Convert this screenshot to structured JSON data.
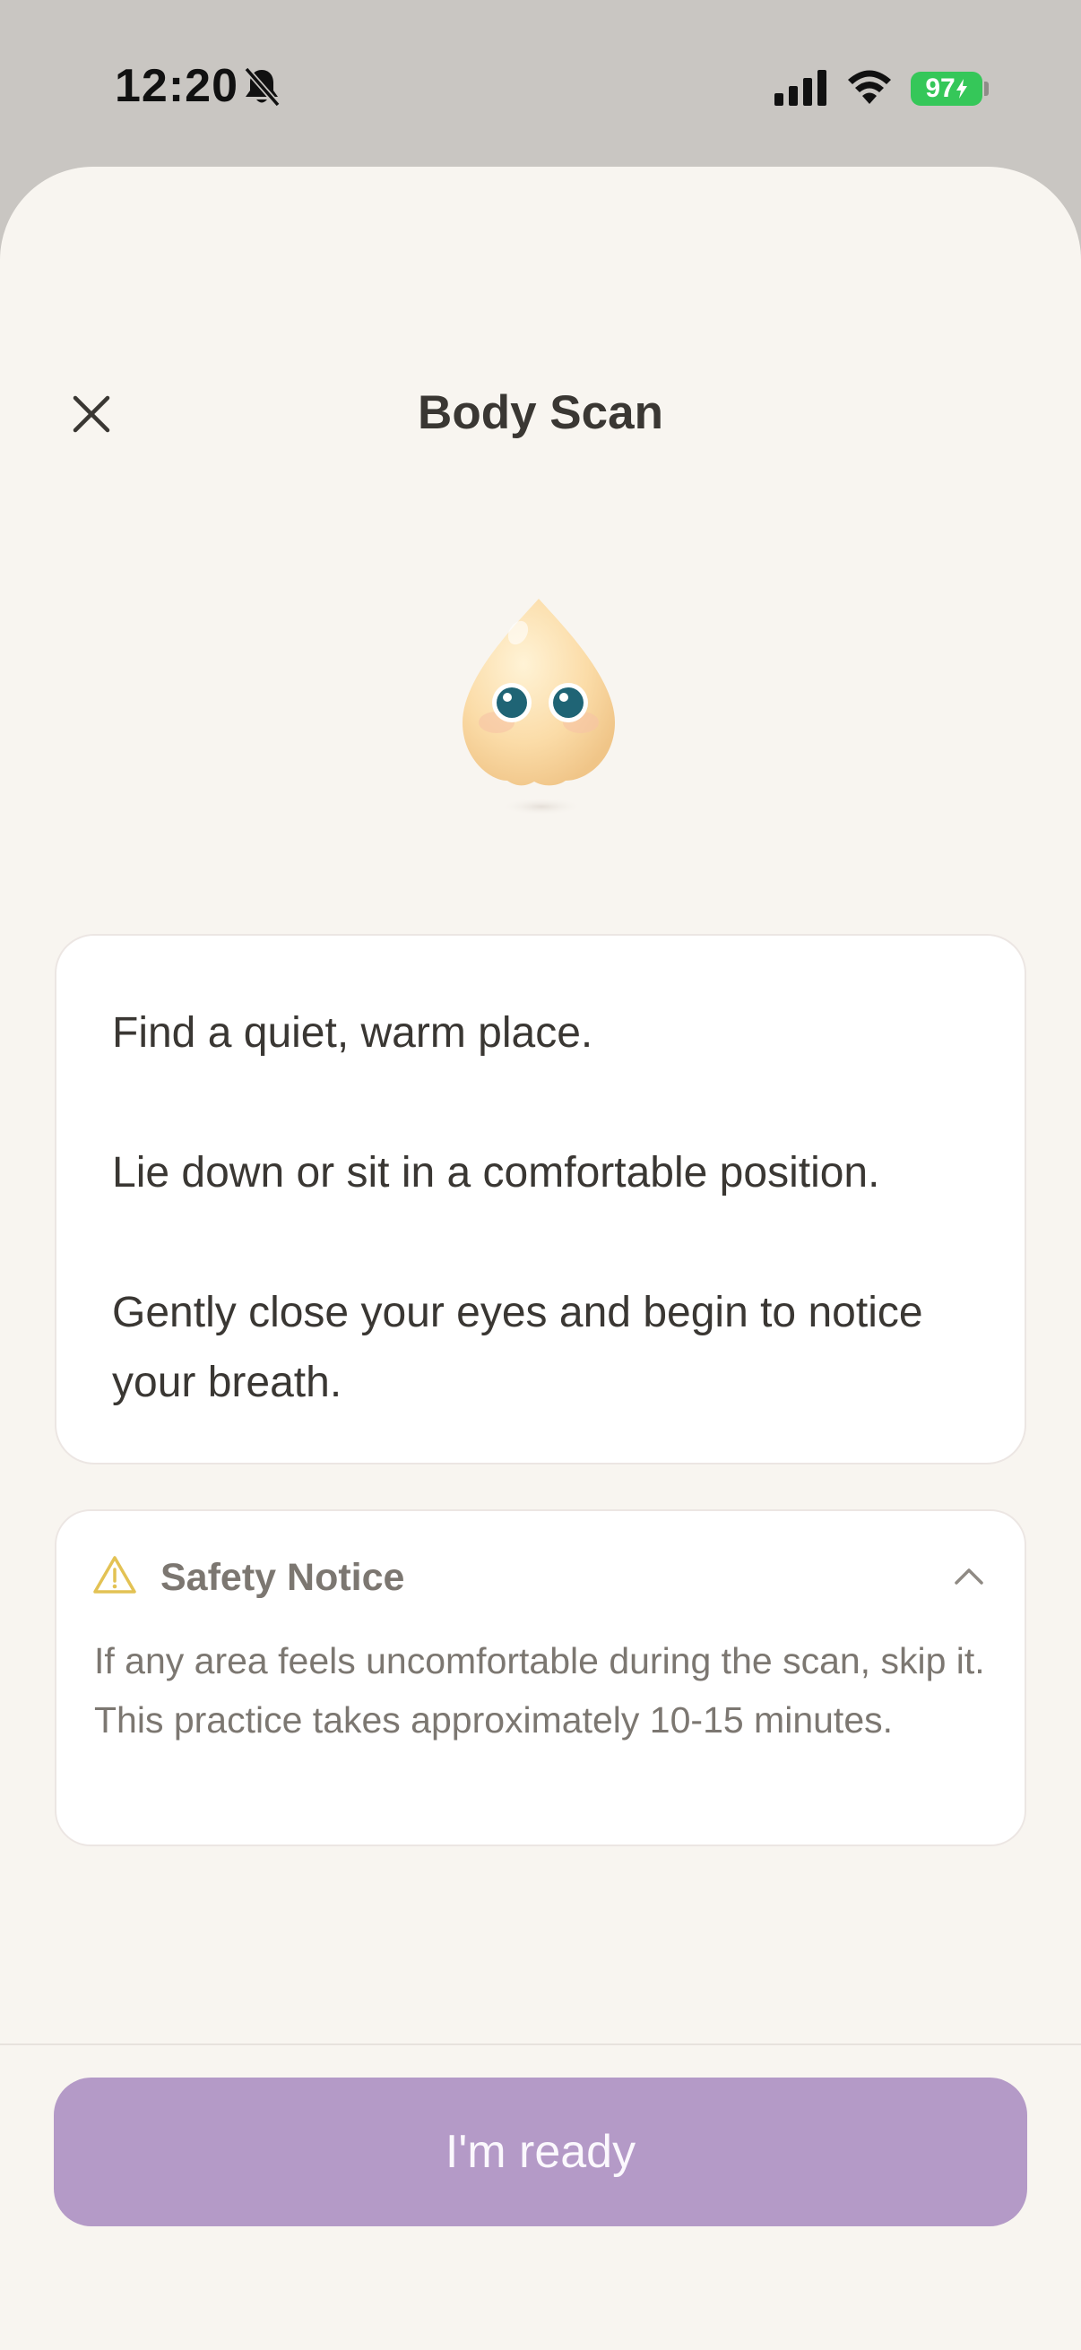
{
  "status_bar": {
    "time": "12:20",
    "bell_icon": "bell-slash-icon",
    "signal_icon": "cellular-signal-icon",
    "wifi_icon": "wifi-icon",
    "battery_level": "97",
    "battery_color": "#35c759"
  },
  "header": {
    "close_icon": "close-icon",
    "title": "Body Scan"
  },
  "instructions": [
    "Find a quiet, warm place.",
    "Lie down or sit in a comfortable position.",
    "Gently close your eyes and begin to notice your breath."
  ],
  "safety_notice": {
    "icon": "warning-icon",
    "title": "Safety Notice",
    "toggle_icon": "chevron-up-icon",
    "body": "If any area feels uncomfortable during the scan, skip it. This practice takes approximately 10-15 minutes."
  },
  "footer": {
    "button_label": "I'm ready",
    "button_color": "#b49ac7"
  }
}
